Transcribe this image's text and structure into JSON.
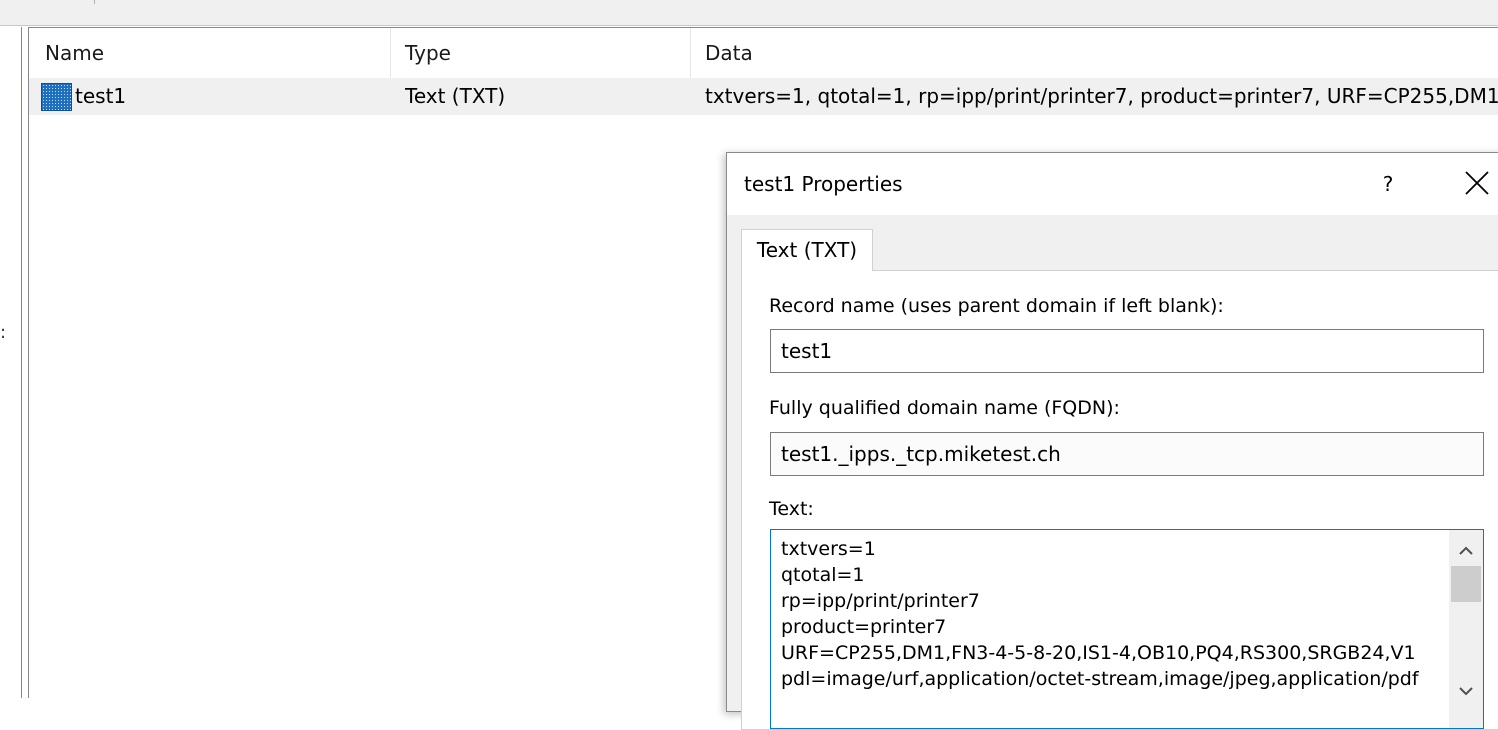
{
  "list": {
    "columns": {
      "name": "Name",
      "type": "Type",
      "data": "Data"
    },
    "rows": [
      {
        "name": "test1",
        "type": "Text (TXT)",
        "data": "txtvers=1, qtotal=1, rp=ipp/print/printer7, product=printer7, URF=CP255,DM1"
      }
    ]
  },
  "left_pane": {
    "fragment": ":"
  },
  "dialog": {
    "title": "test1 Properties",
    "help": "?",
    "tab": "Text (TXT)",
    "record_name_label": "Record name (uses parent domain if left blank):",
    "record_name_value": "test1",
    "fqdn_label": "Fully qualified domain name (FQDN):",
    "fqdn_value": "test1._ipps._tcp.miketest.ch",
    "text_label": "Text:",
    "text_lines": [
      "txtvers=1",
      "qtotal=1",
      "rp=ipp/print/printer7",
      "product=printer7",
      "URF=CP255,DM1,FN3-4-5-8-20,IS1-4,OB10,PQ4,RS300,SRGB24,V1",
      "pdl=image/urf,application/octet-stream,image/jpeg,application/pdf"
    ]
  },
  "icons": {
    "record": "dns-record-icon",
    "close": "close-icon",
    "scroll_up": "chevron-up-icon",
    "scroll_down": "chevron-down-icon"
  },
  "colors": {
    "selection_row": "#f0f0f0",
    "textarea_focus": "#0078d7",
    "record_icon": "#1e6fbf"
  }
}
